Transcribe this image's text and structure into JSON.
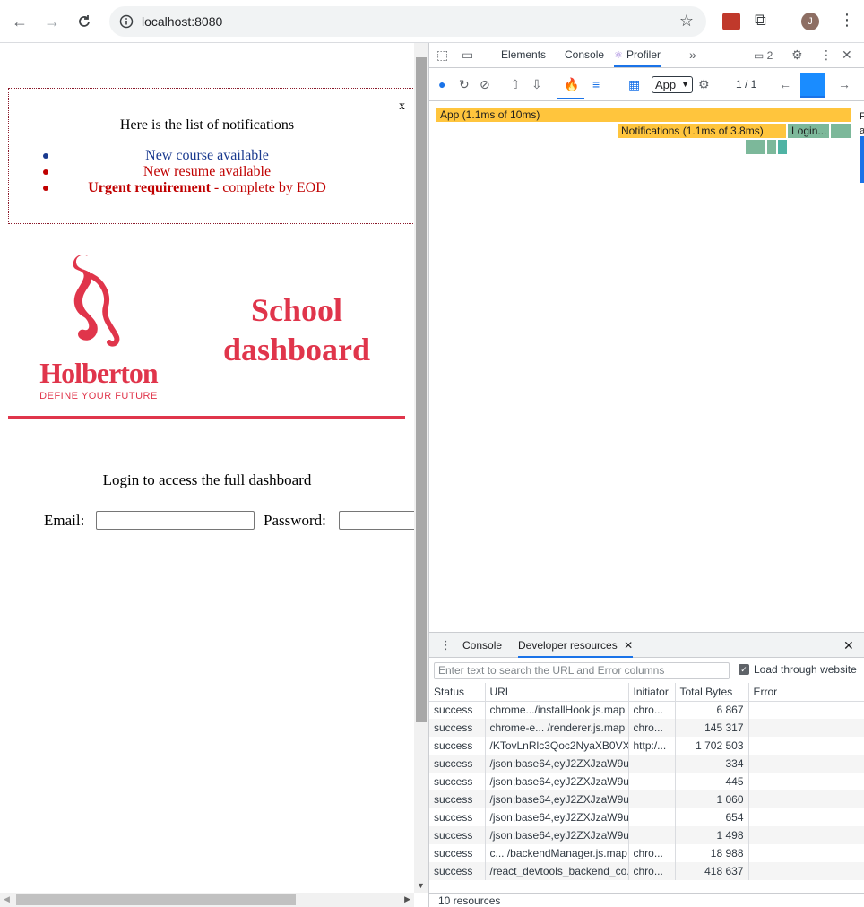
{
  "browser": {
    "url": "localhost:8080",
    "profile_initial": "J"
  },
  "page": {
    "notifications": {
      "close_label": "x",
      "title": "Here is the list of notifications",
      "items": [
        {
          "text": "New course available",
          "color": "#1a3a8f"
        },
        {
          "text": "New resume available",
          "color": "#c00000"
        },
        {
          "strong": "Urgent requirement",
          "rest": " - complete by EOD",
          "color": "#c00000"
        }
      ]
    },
    "logo": {
      "wordmark": "Holberton",
      "tagline": "DEFINE YOUR FUTURE"
    },
    "title_line1": "School",
    "title_line2": "dashboard",
    "login_prompt": "Login to access the full dashboard",
    "email_label": "Email:",
    "password_label": "Password:"
  },
  "devtools": {
    "tabs": [
      "Elements",
      "Console",
      "Profiler"
    ],
    "issues_count": "2",
    "root_select": "App",
    "commit_index": "1 / 1",
    "flame": [
      {
        "label": "App (1.1ms of 10ms)",
        "color": "#ffc53d"
      },
      {
        "label": "Notifications (1.1ms of 3.8ms)",
        "color": "#ffc53d"
      },
      {
        "label": "Login...",
        "color": "#7cb89a"
      }
    ],
    "side_chars": "F a",
    "drawer": {
      "tabs": [
        "Console",
        "Developer resources"
      ],
      "search_placeholder": "Enter text to search the URL and Error columns",
      "load_through_website": "Load through website",
      "columns": [
        "Status",
        "URL",
        "Initiator",
        "Total Bytes",
        "Error"
      ],
      "rows": [
        [
          "success",
          "chrome.../installHook.js.map",
          "chro...",
          "6 867",
          ""
        ],
        [
          "success",
          "chrome-e... /renderer.js.map",
          "chro...",
          "145 317",
          ""
        ],
        [
          "success",
          "/KTovLnRlc3Qoc2NyaXB0VX...",
          "http:/...",
          "1 702 503",
          ""
        ],
        [
          "success",
          "/json;base64,eyJ2ZXJzaW9uI...",
          "",
          "334",
          ""
        ],
        [
          "success",
          "/json;base64,eyJ2ZXJzaW9uI...",
          "",
          "445",
          ""
        ],
        [
          "success",
          "/json;base64,eyJ2ZXJzaW9uI...",
          "",
          "1 060",
          ""
        ],
        [
          "success",
          "/json;base64,eyJ2ZXJzaW9uI...",
          "",
          "654",
          ""
        ],
        [
          "success",
          "/json;base64,eyJ2ZXJzaW9uI...",
          "",
          "1 498",
          ""
        ],
        [
          "success",
          "c... /backendManager.js.map",
          "chro...",
          "18 988",
          ""
        ],
        [
          "success",
          "/react_devtools_backend_co...",
          "chro...",
          "418 637",
          ""
        ]
      ],
      "footer": "10 resources"
    }
  }
}
